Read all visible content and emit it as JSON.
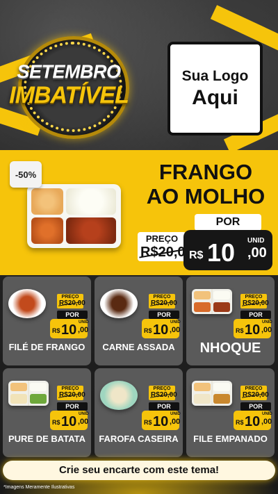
{
  "header": {
    "badge_line1": "SETEMBRO",
    "badge_line2": "IMBATÍVEL",
    "logo_line1": "Sua Logo",
    "logo_line2": "Aqui"
  },
  "featured": {
    "discount": "-50%",
    "title_line1": "FRANGO",
    "title_line2": "AO MOLHO",
    "por_label": "POR",
    "preco_label": "PREÇO",
    "old_price": "R$20,00",
    "currency": "R$",
    "price_int": "10",
    "price_cents": ",00",
    "unit": "UNID"
  },
  "items": [
    {
      "name": "FILÉ DE FRANGO",
      "preco_label": "PREÇO",
      "old_price": "R$20,00",
      "por_label": "POR",
      "currency": "R$",
      "price_int": "10",
      "price_cents": ",00",
      "unit": "UNID"
    },
    {
      "name": "CARNE ASSADA",
      "preco_label": "PREÇO",
      "old_price": "R$20,00",
      "por_label": "POR",
      "currency": "R$",
      "price_int": "10",
      "price_cents": ",00",
      "unit": "UNID"
    },
    {
      "name": "NHOQUE",
      "preco_label": "PREÇO",
      "old_price": "R$20,00",
      "por_label": "POR",
      "currency": "R$",
      "price_int": "10",
      "price_cents": ",00",
      "unit": "UNID"
    },
    {
      "name": "PURE DE BATATA",
      "preco_label": "PREÇO",
      "old_price": "R$20,00",
      "por_label": "POR",
      "currency": "R$",
      "price_int": "10",
      "price_cents": ",00",
      "unit": "UNID"
    },
    {
      "name": "FAROFA CASEIRA",
      "preco_label": "PREÇO",
      "old_price": "R$20,00",
      "por_label": "POR",
      "currency": "R$",
      "price_int": "10",
      "price_cents": ",00",
      "unit": "UNID"
    },
    {
      "name": "FILE EMPANADO",
      "preco_label": "PREÇO",
      "old_price": "R$20,00",
      "por_label": "POR",
      "currency": "R$",
      "price_int": "10",
      "price_cents": ",00",
      "unit": "UNID"
    }
  ],
  "footer": {
    "cta": "Crie seu encarte com este tema!",
    "disclaimer": "*Imagens Meramente Ilustrativas"
  },
  "colors": {
    "accent": "#f6c40b",
    "background": "#1c1c1c",
    "card": "#5a5a5a"
  }
}
